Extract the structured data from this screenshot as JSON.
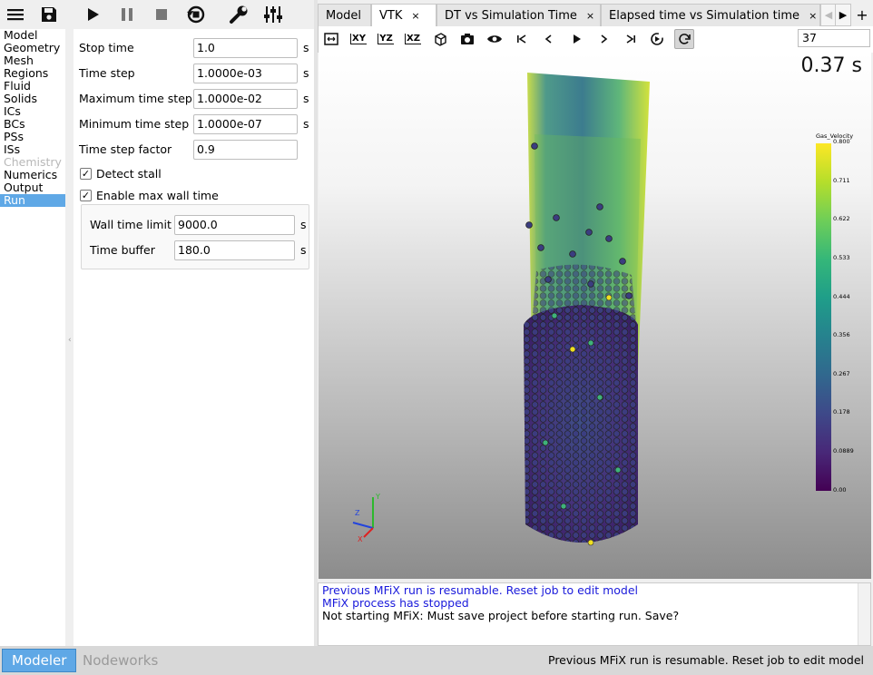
{
  "toolbar": {
    "icons": [
      "menu-icon",
      "save-icon",
      "play-icon",
      "pause-icon",
      "stop-icon",
      "reset-icon",
      "wrench-icon",
      "sliders-icon"
    ]
  },
  "nav": {
    "items": [
      {
        "label": "Model",
        "state": "normal"
      },
      {
        "label": "Geometry",
        "state": "normal"
      },
      {
        "label": "Mesh",
        "state": "normal"
      },
      {
        "label": "Regions",
        "state": "normal"
      },
      {
        "label": "Fluid",
        "state": "normal"
      },
      {
        "label": "Solids",
        "state": "normal"
      },
      {
        "label": "ICs",
        "state": "normal"
      },
      {
        "label": "BCs",
        "state": "normal"
      },
      {
        "label": "PSs",
        "state": "normal"
      },
      {
        "label": "ISs",
        "state": "normal"
      },
      {
        "label": "Chemistry",
        "state": "disabled"
      },
      {
        "label": "Numerics",
        "state": "normal"
      },
      {
        "label": "Output",
        "state": "normal"
      },
      {
        "label": "Run",
        "state": "selected"
      }
    ]
  },
  "run": {
    "stop_time": {
      "label": "Stop time",
      "value": "1.0",
      "unit": "s"
    },
    "time_step": {
      "label": "Time step",
      "value": "1.0000e-03",
      "unit": "s"
    },
    "max_time_step": {
      "label": "Maximum time step",
      "value": "1.0000e-02",
      "unit": "s"
    },
    "min_time_step": {
      "label": "Minimum time step",
      "value": "1.0000e-07",
      "unit": "s"
    },
    "time_step_factor": {
      "label": "Time step factor",
      "value": "0.9"
    },
    "detect_stall": {
      "label": "Detect stall",
      "checked": true,
      "mark": "✓"
    },
    "enable_max_wall_time": {
      "label": "Enable max wall time",
      "checked": true,
      "mark": "✓"
    },
    "wall_time_limit": {
      "label": "Wall time limit",
      "value": "9000.0",
      "unit": "s"
    },
    "time_buffer": {
      "label": "Time buffer",
      "value": "180.0",
      "unit": "s"
    }
  },
  "tabs": [
    {
      "label": "Model",
      "closable": false,
      "active": false
    },
    {
      "label": "VTK",
      "closable": true,
      "active": true
    },
    {
      "label": "DT vs Simulation Time",
      "closable": true,
      "active": false
    },
    {
      "label": "Elapsed time vs Simulation time",
      "closable": true,
      "active": false
    }
  ],
  "tab_close_glyph": "×",
  "tab_add_glyph": "+",
  "vtk": {
    "buttons": [
      "fit-view",
      "XY",
      "YZ",
      "XZ",
      "perspective",
      "screenshot",
      "visibility",
      "first-frame",
      "prev-frame",
      "play",
      "next-frame",
      "last-frame",
      "play-speed",
      "refresh"
    ],
    "view_labels": {
      "xy": "XY",
      "yz": "YZ",
      "xz": "XZ"
    },
    "frame": "37",
    "time_label": "0.37 s",
    "colorbar": {
      "title": "Gas_Velocity",
      "ticks": [
        "0.800",
        "0.711",
        "0.622",
        "0.533",
        "0.444",
        "0.356",
        "0.267",
        "0.178",
        "0.0889",
        "0.00"
      ]
    },
    "axes": {
      "x": "X",
      "y": "Y",
      "z": "Z"
    }
  },
  "console": {
    "lines": [
      {
        "text": "Previous MFiX run is resumable.  Reset job to edit model",
        "color": "#1a1adb"
      },
      {
        "text": "MFiX process has stopped",
        "color": "#1a1adb"
      },
      {
        "text": "Not starting MFiX: Must save project before starting run. Save?",
        "color": "#000000"
      }
    ]
  },
  "statusbar": {
    "modes": [
      {
        "label": "Modeler",
        "active": true
      },
      {
        "label": "Nodeworks",
        "active": false
      }
    ],
    "message": "Previous MFiX run is resumable.  Reset job to edit model"
  },
  "colors": {
    "accent": "#5fa8e6",
    "log_blue": "#1a1adb"
  }
}
